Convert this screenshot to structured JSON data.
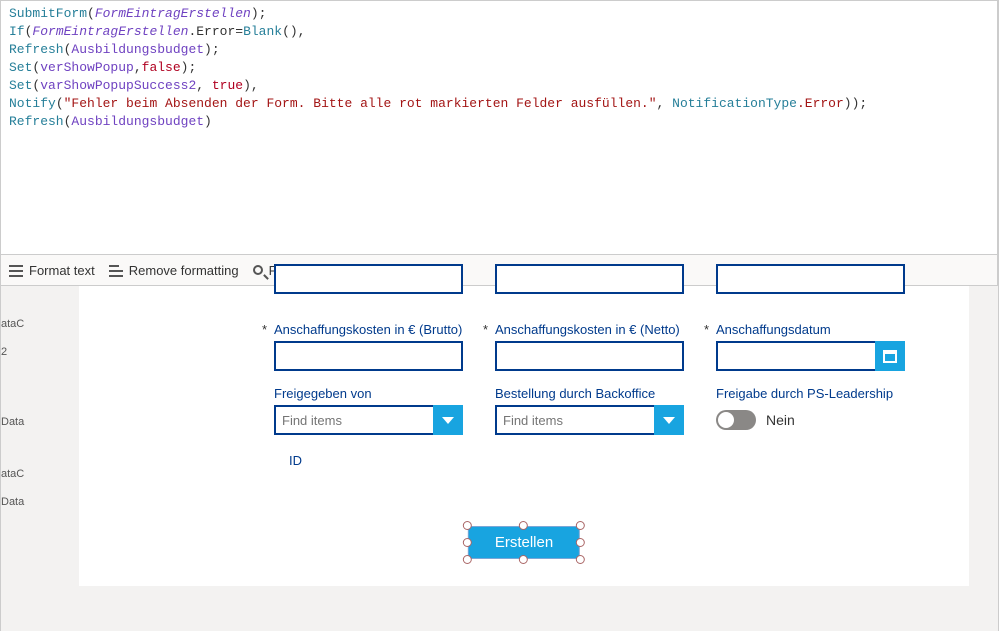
{
  "code": {
    "l1": {
      "fn": "SubmitForm",
      "arg": "FormEintragErstellen"
    },
    "l2": {
      "kw": "If",
      "ref": "FormEintragErstellen",
      "prop": ".Error=",
      "fn": "Blank"
    },
    "l3": {
      "fn": "Refresh",
      "arg": "Ausbildungsbudget"
    },
    "l4": {
      "fn": "Set",
      "arg1": "verShowPopup",
      "arg2": "false"
    },
    "l5": {
      "fn": "Set",
      "arg1": "varShowPopupSuccess2",
      "arg2": "true"
    },
    "l6": {
      "fn": "Notify",
      "str": "\"Fehler beim Absenden der Form. Bitte alle rot markierten Felder ausfüllen.\"",
      "type1": "NotificationType",
      "type2": ".Error"
    },
    "l7": {
      "fn": "Refresh",
      "arg": "Ausbildungsbudget"
    }
  },
  "toolbar": {
    "format": "Format text",
    "remove": "Remove formatting",
    "find": "Find and replace"
  },
  "side": {
    "s1": "ataC",
    "s2": "2",
    "s3": "Data",
    "s4": "ataC",
    "s5": "Data"
  },
  "form": {
    "row1": {
      "brutto_label": "Anschaffungskosten in € (Brutto)",
      "netto_label": "Anschaffungskosten in € (Netto)",
      "datum_label": "Anschaffungsdatum"
    },
    "row2": {
      "freigegeben_label": "Freigegeben von",
      "freigegeben_placeholder": "Find items",
      "bestellung_label": "Bestellung durch Backoffice",
      "bestellung_placeholder": "Find items",
      "freigabe_label": "Freigabe durch PS-Leadership",
      "toggle_value": "Nein"
    },
    "id_label": "ID",
    "create_label": "Erstellen"
  }
}
